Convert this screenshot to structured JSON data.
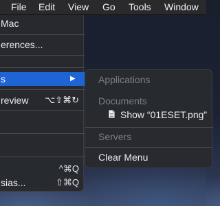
{
  "menubar": {
    "items": [
      "File",
      "Edit",
      "View",
      "Go",
      "Tools",
      "Window"
    ]
  },
  "main_menu": {
    "about_label": "Mac",
    "preferences_label": "erences...",
    "recent_items_label": "s",
    "preview_label": "review",
    "preview_shortcut": "⌥⇧⌘↻",
    "quit_shortcut": "^⌘Q",
    "force_quit_label": "sias...",
    "force_quit_shortcut": "⇧⌘Q"
  },
  "recent_submenu": {
    "applications_header": "Applications",
    "documents_header": "Documents",
    "document_item": "Show “01ESET.png”",
    "servers_header": "Servers",
    "clear_menu_label": "Clear Menu"
  },
  "colors": {
    "highlight": "#1e64d4",
    "menu_bg": "#282a2e",
    "disabled_text": "#7d7e84"
  }
}
